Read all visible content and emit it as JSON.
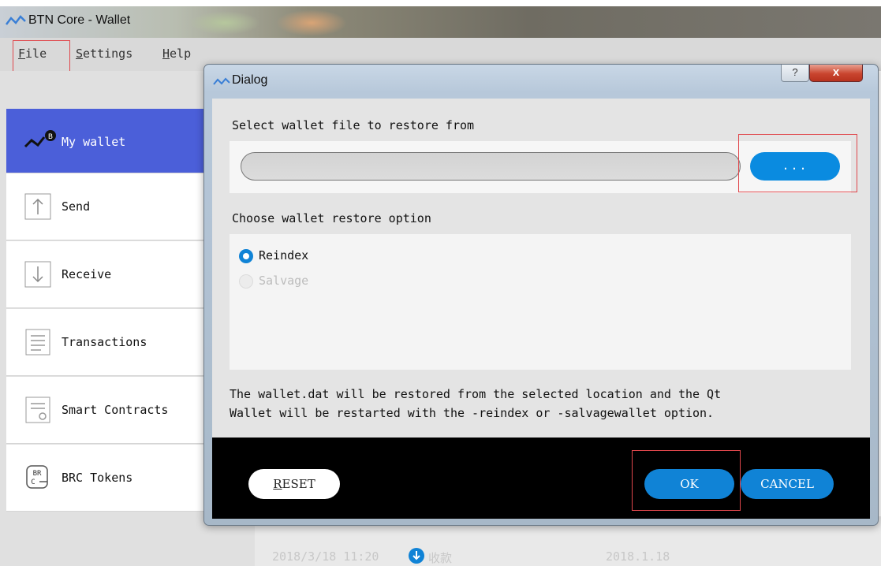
{
  "window": {
    "title": "BTN Core - Wallet",
    "icon": "btn-logo-icon"
  },
  "menu": {
    "items": [
      {
        "label": "File",
        "mnemonic": "F",
        "rest": "ile"
      },
      {
        "label": "Settings",
        "mnemonic": "S",
        "rest": "ettings"
      },
      {
        "label": "Help",
        "mnemonic": "H",
        "rest": "elp"
      }
    ]
  },
  "sidebar": {
    "items": [
      {
        "label": "My wallet",
        "icon": "wallet-logo-icon",
        "active": true
      },
      {
        "label": "Send",
        "icon": "arrow-up-icon"
      },
      {
        "label": "Receive",
        "icon": "arrow-down-icon"
      },
      {
        "label": "Transactions",
        "icon": "document-list-icon"
      },
      {
        "label": "Smart Contracts",
        "icon": "contract-icon"
      },
      {
        "label": "BRC Tokens",
        "icon": "brc-token-icon"
      }
    ]
  },
  "background_row": {
    "date": "2018/3/18 11:20",
    "type": "收款",
    "date2": "2018.1.18"
  },
  "dialog": {
    "title": "Dialog",
    "help_label": "?",
    "close_label": "x",
    "select_file_label": "Select wallet file to restore from",
    "path_value": "",
    "browse_label": "...",
    "restore_option_label": "Choose wallet restore option",
    "options": [
      {
        "label": "Reindex",
        "checked": true,
        "enabled": true
      },
      {
        "label": "Salvage",
        "checked": false,
        "enabled": false
      }
    ],
    "info_line1": "The wallet.dat will be restored from the selected location and the Qt",
    "info_line2": "Wallet will be restarted with the -reindex or -salvagewallet option.",
    "reset_label": "RESET",
    "reset_mnemonic": "R",
    "reset_rest": "ESET",
    "ok_label": "OK",
    "cancel_label": "CANCEL"
  },
  "colors": {
    "accent": "#1083d6",
    "sidebar_active": "#4b5fd9",
    "highlight_box": "#e0474c"
  }
}
